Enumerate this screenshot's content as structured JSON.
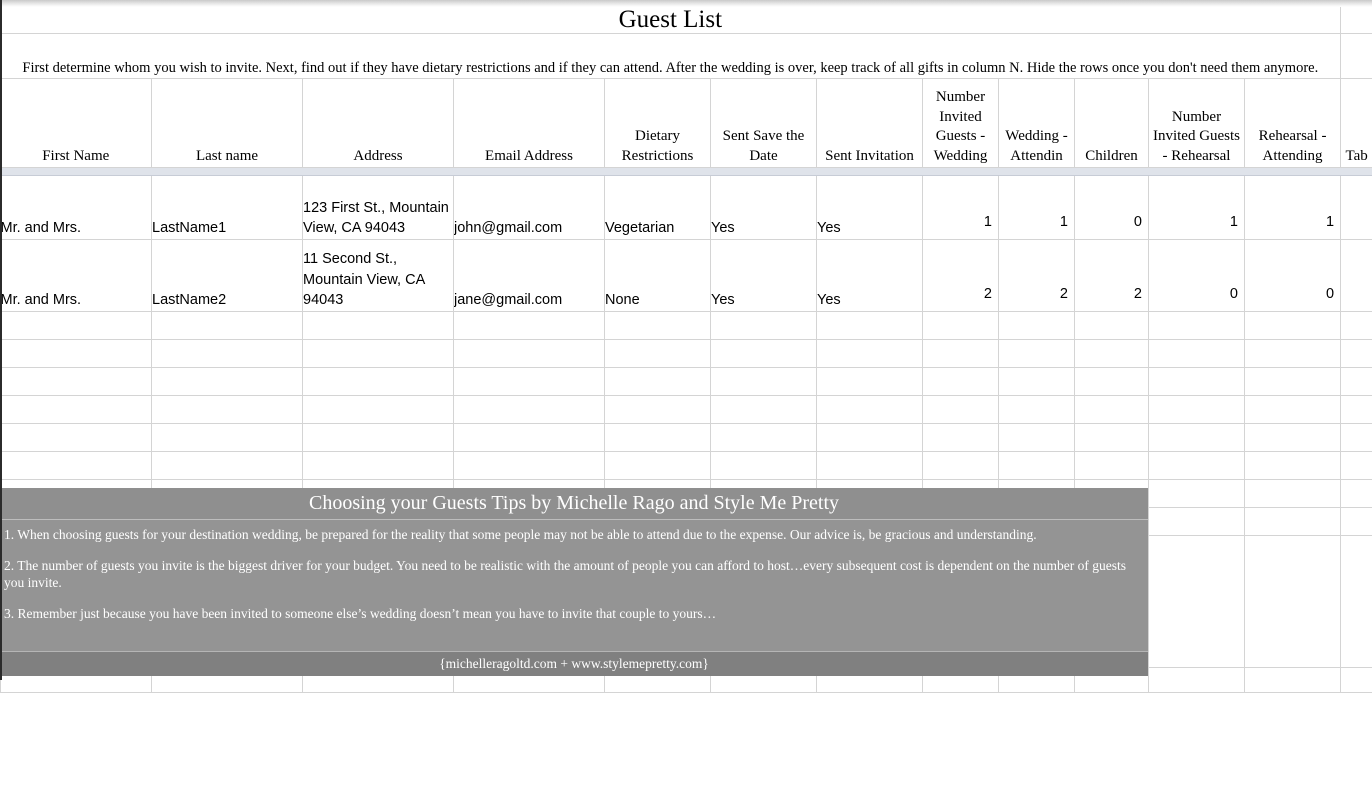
{
  "document": {
    "title": "Guest List",
    "instructions": "First determine whom you wish to invite. Next, find out if they have dietary restrictions and if they can attend. After the wedding is over, keep track of all gifts in column N. Hide the rows once you don't need them anymore."
  },
  "table": {
    "columns": [
      "First Name",
      "Last name",
      "Address",
      "Email Address",
      "Dietary Restrictions",
      "Sent Save the Date",
      "Sent Invitation",
      "Number Invited Guests - Wedding",
      "Wedding - Attendin",
      "Children",
      "Number Invited Guests - Rehearsal",
      "Rehearsal - Attending",
      "Tab"
    ],
    "rows": [
      {
        "first_name": "Mr. and Mrs.",
        "last_name": "LastName1",
        "address": "123 First St., Mountain View, CA 94043",
        "email": "john@gmail.com",
        "dietary": "Vegetarian",
        "sent_save_the_date": "Yes",
        "sent_invitation": "Yes",
        "invited_wedding": "1",
        "wedding_attending": "1",
        "children": "0",
        "invited_rehearsal": "1",
        "rehearsal_attending": "1",
        "tab": ""
      },
      {
        "first_name": "Mr. and Mrs.",
        "last_name": "LastName2",
        "address": "11 Second St., Mountain View, CA 94043",
        "email": "jane@gmail.com",
        "dietary": "None",
        "sent_save_the_date": "Yes",
        "sent_invitation": "Yes",
        "invited_wedding": "2",
        "wedding_attending": "2",
        "children": "2",
        "invited_rehearsal": "0",
        "rehearsal_attending": "0",
        "tab": ""
      }
    ],
    "blank_row_count": 7
  },
  "tips": {
    "heading": "Choosing your Guests Tips by Michelle Rago and Style Me Pretty",
    "items": [
      "1. When choosing guests for your destination wedding, be prepared for the reality that some people may not be able to attend due to the expense. Our advice is, be gracious and understanding.",
      "2. The number of guests you invite is the biggest driver for your budget. You need to be realistic with the amount of people you can afford to host…every subsequent cost is dependent on the number of guests you invite.",
      "3. Remember just because you have been invited to someone else’s wedding doesn’t mean you have to invite that couple to yours…"
    ],
    "footer": "{michelleragoltd.com + www.stylemepretty.com}"
  },
  "colors": {
    "tips_heading_bg": "#8f8f8f",
    "tips_body_bg": "#949494",
    "tips_footer_bg": "#808080",
    "grid_line": "#d4d4d4",
    "text": "#000000",
    "tips_text": "#ffffff"
  }
}
